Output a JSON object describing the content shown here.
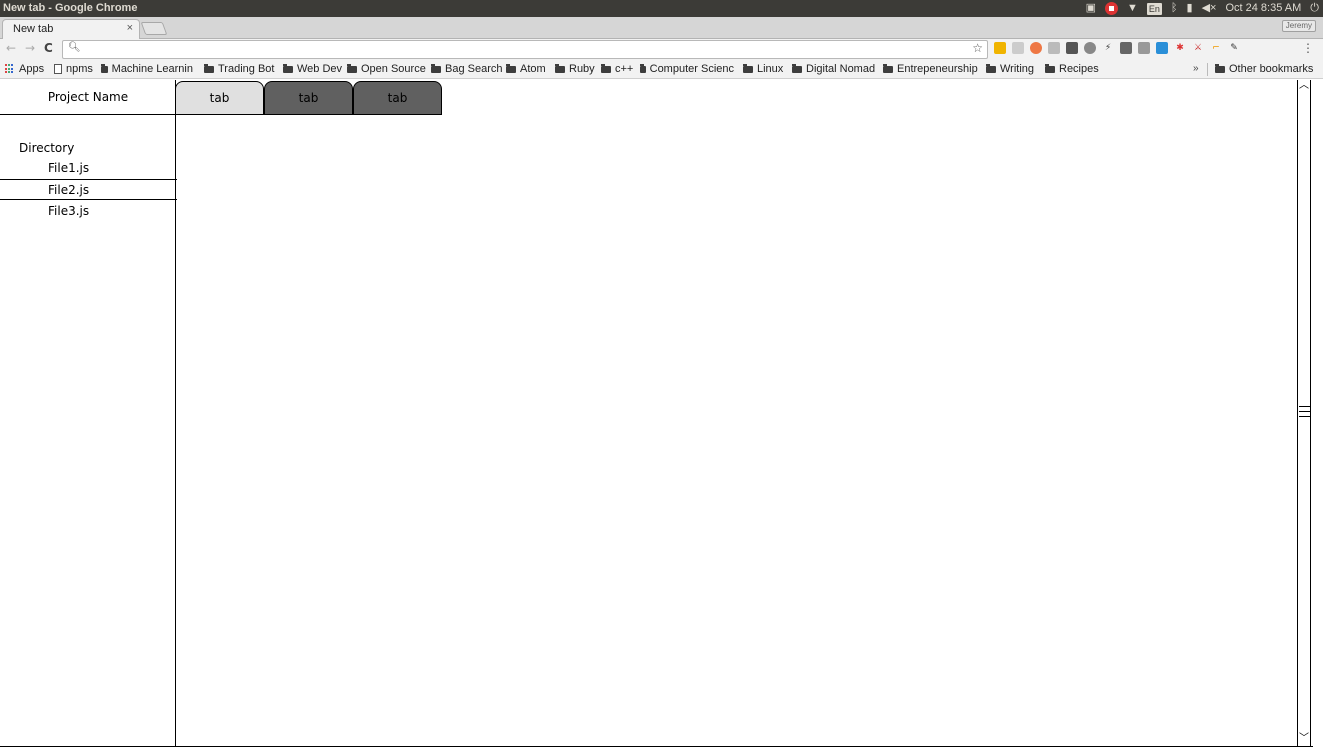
{
  "os_panel": {
    "window_title": "New tab - Google Chrome",
    "keyboard_layout": "En",
    "clock": "Oct 24  8:35 AM"
  },
  "browser": {
    "tab_title": "New tab",
    "tab_close": "×",
    "profile_label": "Jeremy",
    "address_value": "",
    "address_placeholder": "",
    "bookmarks": [
      {
        "label": "Apps",
        "icon": "apps-grid-icon"
      },
      {
        "label": "npms",
        "icon": "page-icon"
      },
      {
        "label": "Machine Learnin",
        "icon": "folder-icon"
      },
      {
        "label": "Trading Bot",
        "icon": "folder-icon"
      },
      {
        "label": "Web Dev",
        "icon": "folder-icon"
      },
      {
        "label": "Open Source",
        "icon": "folder-icon"
      },
      {
        "label": "Bag Search",
        "icon": "folder-icon"
      },
      {
        "label": "Atom",
        "icon": "folder-icon"
      },
      {
        "label": "Ruby",
        "icon": "folder-icon"
      },
      {
        "label": "c++",
        "icon": "folder-icon"
      },
      {
        "label": "Computer Scienc",
        "icon": "folder-icon"
      },
      {
        "label": "Linux",
        "icon": "folder-icon"
      },
      {
        "label": "Digital Nomad",
        "icon": "folder-icon"
      },
      {
        "label": "Entrepeneurship",
        "icon": "folder-icon"
      },
      {
        "label": "Writing",
        "icon": "folder-icon"
      },
      {
        "label": "Recipes",
        "icon": "folder-icon"
      }
    ],
    "bookmarks_overflow": "»",
    "other_bookmarks": "Other bookmarks"
  },
  "mockup": {
    "project_name": "Project Name",
    "directory_label": "Directory",
    "files": [
      "File1.js",
      "File2.js",
      "File3.js"
    ],
    "selected_file": "File2.js",
    "tabs": [
      {
        "label": "tab",
        "state": "active"
      },
      {
        "label": "tab",
        "state": "inactive"
      },
      {
        "label": "tab",
        "state": "inactive"
      }
    ]
  },
  "colors": {
    "os_panel_bg": "#3c3b37",
    "chrome_toolbar_bg": "#f2f2f2",
    "active_tab_bg": "#e0e0e0",
    "inactive_tab_bg": "#606060"
  }
}
